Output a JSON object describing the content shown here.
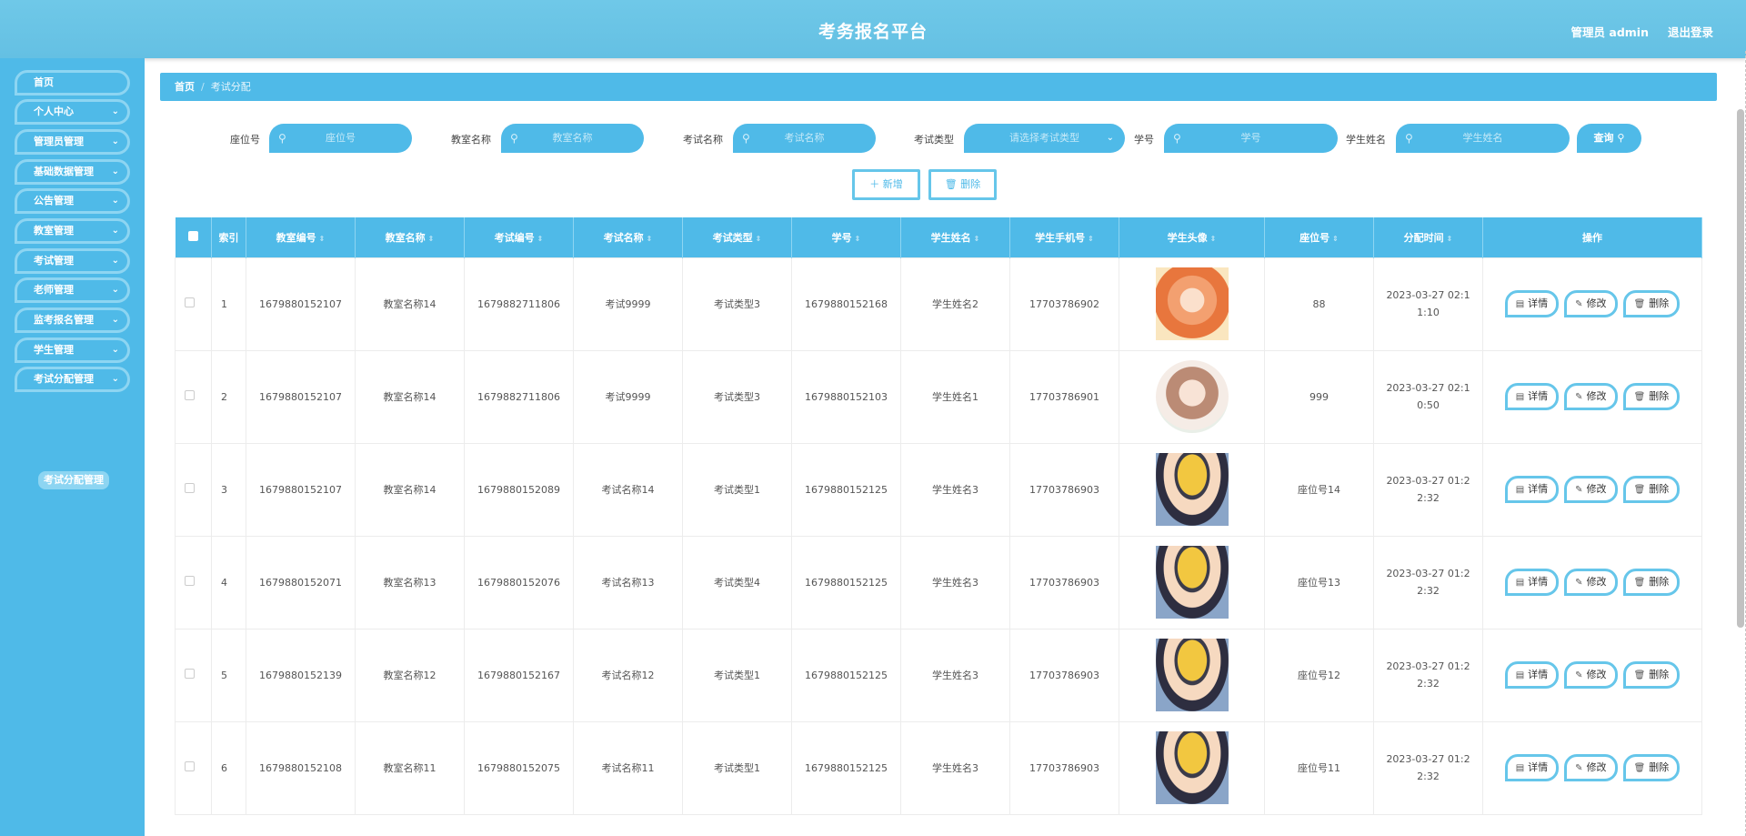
{
  "header": {
    "title": "考务报名平台",
    "admin": "管理员 admin",
    "logout": "退出登录"
  },
  "sidebar": {
    "items": [
      {
        "label": "首页",
        "chevron": false
      },
      {
        "label": "个人中心",
        "chevron": true
      },
      {
        "label": "管理员管理",
        "chevron": true
      },
      {
        "label": "基础数据管理",
        "chevron": true
      },
      {
        "label": "公告管理",
        "chevron": true
      },
      {
        "label": "教室管理",
        "chevron": true
      },
      {
        "label": "考试管理",
        "chevron": true
      },
      {
        "label": "老师管理",
        "chevron": true
      },
      {
        "label": "监考报名管理",
        "chevron": true
      },
      {
        "label": "学生管理",
        "chevron": true
      },
      {
        "label": "考试分配管理",
        "chevron": true
      }
    ],
    "active_sub": "考试分配管理"
  },
  "breadcrumb": {
    "home": "首页",
    "sep": "/",
    "current": "考试分配"
  },
  "search": {
    "seat_label": "座位号",
    "seat_placeholder": "座位号",
    "room_label": "教室名称",
    "room_placeholder": "教室名称",
    "exam_label": "考试名称",
    "exam_placeholder": "考试名称",
    "type_label": "考试类型",
    "type_placeholder": "请选择考试类型",
    "sid_label": "学号",
    "sid_placeholder": "学号",
    "sname_label": "学生姓名",
    "sname_placeholder": "学生姓名",
    "query": "查询"
  },
  "actions": {
    "add": "新增",
    "delete": "删除"
  },
  "table": {
    "headers": [
      "索引",
      "教室编号",
      "教室名称",
      "考试编号",
      "考试名称",
      "考试类型",
      "学号",
      "学生姓名",
      "学生手机号",
      "学生头像",
      "座位号",
      "分配时间",
      "操作"
    ],
    "rows": [
      {
        "idx": "1",
        "room_no": "1679880152107",
        "room_name": "教室名称14",
        "exam_no": "1679882711806",
        "exam_name": "考试9999",
        "exam_type": "考试类型3",
        "sid": "1679880152168",
        "sname": "学生姓名2",
        "phone": "17703786902",
        "avatar": "girl1",
        "seat": "88",
        "time": "2023-03-27 02:11:10"
      },
      {
        "idx": "2",
        "room_no": "1679880152107",
        "room_name": "教室名称14",
        "exam_no": "1679882711806",
        "exam_name": "考试9999",
        "exam_type": "考试类型3",
        "sid": "1679880152103",
        "sname": "学生姓名1",
        "phone": "17703786901",
        "avatar": "girl2",
        "seat": "999",
        "time": "2023-03-27 02:10:50"
      },
      {
        "idx": "3",
        "room_no": "1679880152107",
        "room_name": "教室名称14",
        "exam_no": "1679880152089",
        "exam_name": "考试名称14",
        "exam_type": "考试类型1",
        "sid": "1679880152125",
        "sname": "学生姓名3",
        "phone": "17703786903",
        "avatar": "boy",
        "seat": "座位号14",
        "time": "2023-03-27 01:22:32"
      },
      {
        "idx": "4",
        "room_no": "1679880152071",
        "room_name": "教室名称13",
        "exam_no": "1679880152076",
        "exam_name": "考试名称13",
        "exam_type": "考试类型4",
        "sid": "1679880152125",
        "sname": "学生姓名3",
        "phone": "17703786903",
        "avatar": "boy",
        "seat": "座位号13",
        "time": "2023-03-27 01:22:32"
      },
      {
        "idx": "5",
        "room_no": "1679880152139",
        "room_name": "教室名称12",
        "exam_no": "1679880152167",
        "exam_name": "考试名称12",
        "exam_type": "考试类型1",
        "sid": "1679880152125",
        "sname": "学生姓名3",
        "phone": "17703786903",
        "avatar": "boy",
        "seat": "座位号12",
        "time": "2023-03-27 01:22:32"
      },
      {
        "idx": "6",
        "room_no": "1679880152108",
        "room_name": "教室名称11",
        "exam_no": "1679880152075",
        "exam_name": "考试名称11",
        "exam_type": "考试类型1",
        "sid": "1679880152125",
        "sname": "学生姓名3",
        "phone": "17703786903",
        "avatar": "boy",
        "seat": "座位号11",
        "time": "2023-03-27 01:22:32"
      }
    ],
    "op_labels": {
      "detail": "详情",
      "edit": "修改",
      "delete": "删除"
    }
  },
  "colors": {
    "primary": "#4fbae8",
    "header": "#6fc8e8",
    "border_light": "#8dd5f2"
  },
  "icons": {
    "search": "search-icon",
    "dropdown": "chevron-down-icon",
    "plus": "plus-icon",
    "trash": "trash-icon",
    "doc": "document-icon",
    "pencil": "pencil-icon"
  }
}
